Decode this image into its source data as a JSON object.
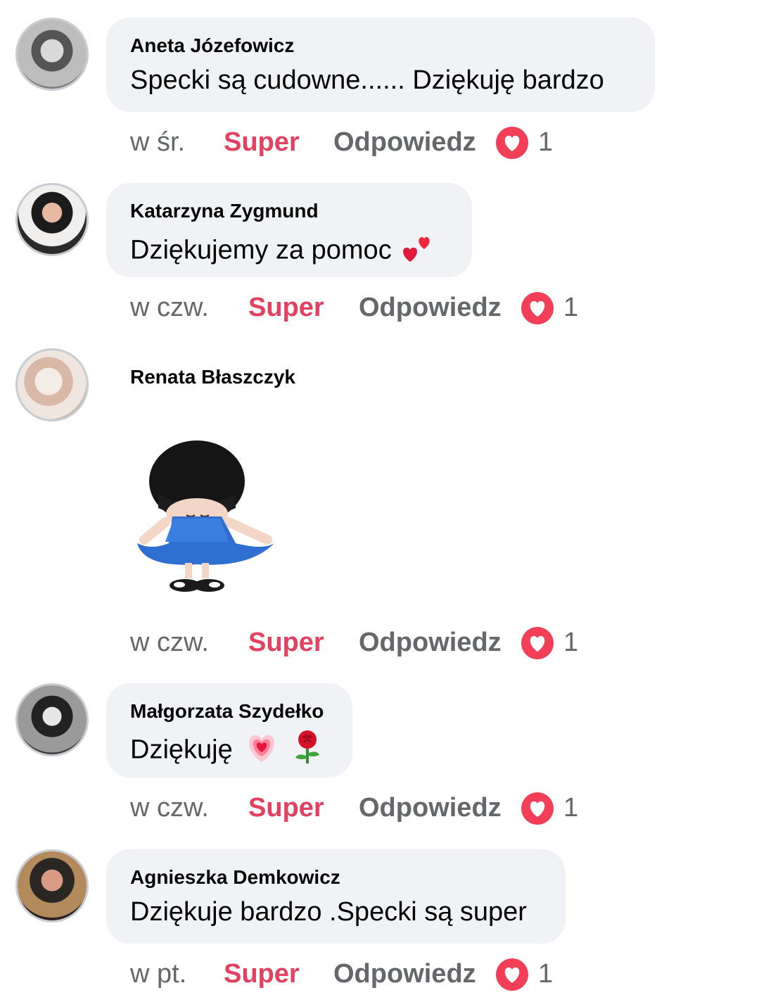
{
  "comments": [
    {
      "author": "Aneta Józefowicz",
      "text": "Specki są cudowne...... Dziękuję bardzo",
      "time": "w śr.",
      "like_label": "Super",
      "reply_label": "Odpowiedz",
      "reaction_count": "1"
    },
    {
      "author": "Katarzyna Zygmund",
      "text": "Dziękujemy za pomoc",
      "emoji": "two-hearts",
      "time": "w czw.",
      "like_label": "Super",
      "reply_label": "Odpowiedz",
      "reaction_count": "1"
    },
    {
      "author": "Renata Błaszczyk",
      "sticker": "girl-in-blue-dress-curtsy",
      "time": "w czw.",
      "like_label": "Super",
      "reply_label": "Odpowiedz",
      "reaction_count": "1"
    },
    {
      "author": "Małgorzata Szydełko",
      "text": "Dziękuję",
      "emoji": [
        "growing-heart",
        "rose"
      ],
      "time": "w czw.",
      "like_label": "Super",
      "reply_label": "Odpowiedz",
      "reaction_count": "1"
    },
    {
      "author": "Agnieszka Demkowicz",
      "text": "Dziękuje bardzo .Specki są super",
      "time": "w pt.",
      "like_label": "Super",
      "reply_label": "Odpowiedz",
      "reaction_count": "1"
    }
  ],
  "colors": {
    "bubble": "#f0f2f5",
    "like": "#e4405f",
    "meta": "#65676b",
    "heart": "#f33e58"
  }
}
